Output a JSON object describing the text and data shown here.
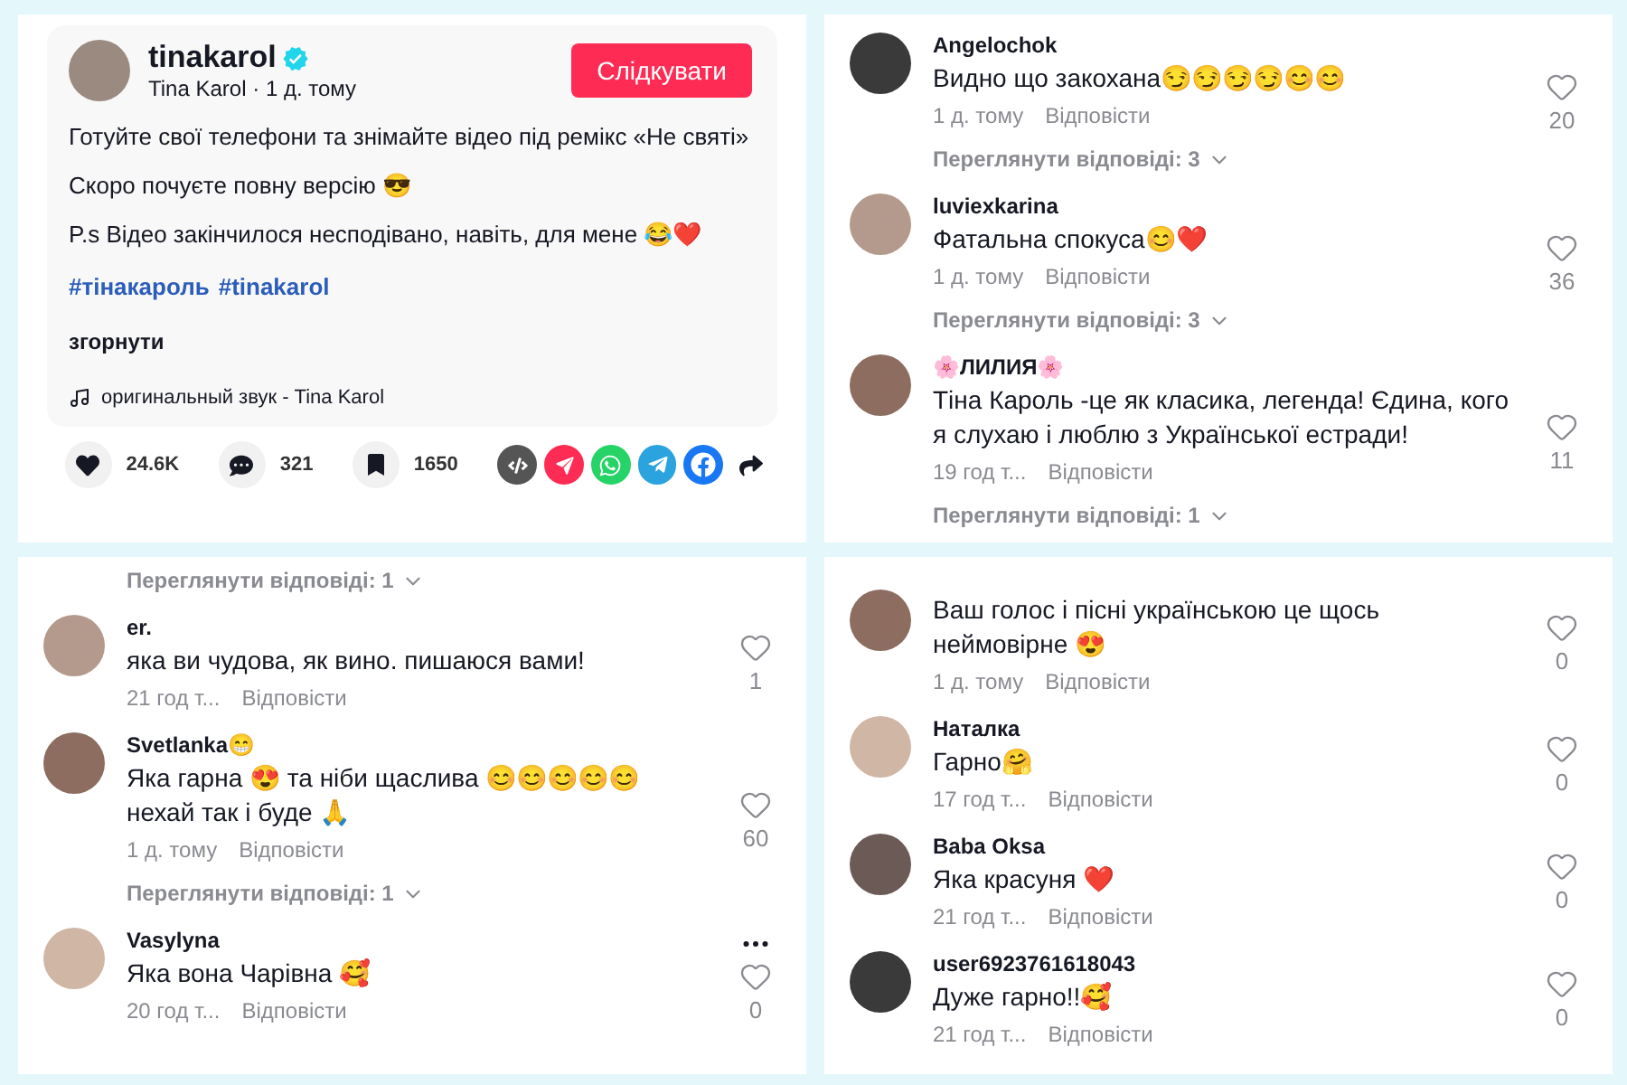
{
  "post": {
    "username": "tinakarol",
    "verified": true,
    "display_name": "Tina Karol",
    "separator": "·",
    "time": "1 д. тому",
    "follow_button": "Слідкувати",
    "lines": [
      "Готуйте свої телефони та знімайте відео під ремікс «Не святі»",
      "Скоро почуєте повну версію 😎",
      "P.s Відео закінчилося несподівано, навіть, для мене 😂❤️"
    ],
    "hashtags": [
      "#тінакароль",
      "#tinakarol"
    ],
    "collapse": "згорнути",
    "sound": "оригинальный звук - Tina Karol",
    "stats": {
      "likes": "24.6K",
      "comments": "321",
      "saves": "1650"
    }
  },
  "panels": [
    {
      "comments": [
        {
          "username": "Angelochok",
          "text": "Видно що закохана😏😏😏😏😊😊",
          "time": "1 д. тому",
          "reply": "Відповісти",
          "likes": "20",
          "replies_link": "Переглянути відповіді: 3"
        },
        {
          "username": "luviexkarina",
          "text": "Фатальна спокуса😊❤️",
          "time": "1 д. тому",
          "reply": "Відповісти",
          "likes": "36",
          "replies_link": "Переглянути відповіді: 3"
        },
        {
          "username": "🌸ЛИЛИЯ🌸",
          "text": "Тіна Кароль -це як класика, легенда! Єдина, кого я слухаю і люблю з Української естради!",
          "time": "19 год т...",
          "reply": "Відповісти",
          "likes": "11",
          "replies_link": "Переглянути відповіді: 1"
        }
      ]
    },
    {
      "top_replies_link": "Переглянути відповіді: 1",
      "comments": [
        {
          "username": "er.",
          "text": "яка ви чудова, як вино. пишаюся вами!",
          "time": "21 год т...",
          "reply": "Відповісти",
          "likes": "1"
        },
        {
          "username": "Svetlanka😁",
          "text": "Яка гарна 😍 та ніби щаслива 😊😊😊😊😊 нехай так і буде 🙏",
          "time": "1 д. тому",
          "reply": "Відповісти",
          "likes": "60",
          "replies_link": "Переглянути відповіді: 1"
        },
        {
          "username": "Vasylyna",
          "text": "Яка вона Чарівна 🥰",
          "time": "20 год т...",
          "reply": "Відповісти",
          "likes": "0",
          "more_menu": true
        }
      ]
    },
    {
      "comments": [
        {
          "text": "Ваш голос і пісні українською це щось неймовірне 😍",
          "time": "1 д. тому",
          "reply": "Відповісти",
          "likes": "0"
        },
        {
          "username": "Наталка",
          "text": "Гарно🤗",
          "time": "17 год т...",
          "reply": "Відповісти",
          "likes": "0"
        },
        {
          "username": "Baba Oksa",
          "text": "Яка красуня ❤️",
          "time": "21 год т...",
          "reply": "Відповісти",
          "likes": "0"
        },
        {
          "username": "user6923761618043",
          "text": "Дуже гарно!!🥰",
          "time": "21 год т...",
          "reply": "Відповісти",
          "likes": "0"
        }
      ]
    }
  ]
}
